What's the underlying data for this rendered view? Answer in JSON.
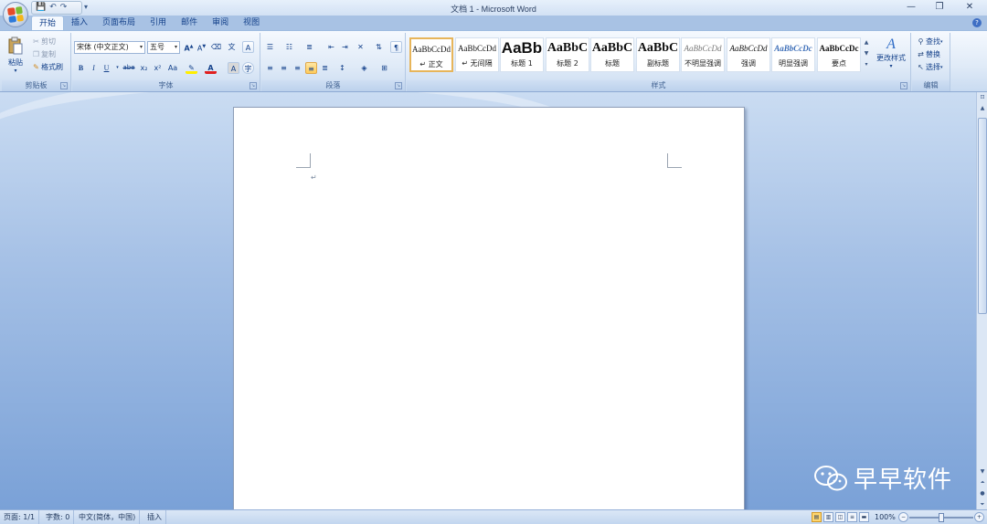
{
  "window": {
    "title": "文档 1 - Microsoft Word",
    "minimize": "—",
    "restore": "❐",
    "close": "✕"
  },
  "qat": {
    "save": "💾",
    "undo": "↶",
    "redo": "↷",
    "more": "▾"
  },
  "tabs": [
    "开始",
    "插入",
    "页面布局",
    "引用",
    "邮件",
    "审阅",
    "视图"
  ],
  "help": "?",
  "clipboard": {
    "label": "剪贴板",
    "paste": "粘贴",
    "cut": "剪切",
    "copy": "复制",
    "format_painter": "格式刷"
  },
  "font": {
    "label": "字体",
    "name": "宋体 (中文正文)",
    "size": "五号",
    "bold": "B",
    "italic": "I",
    "underline": "U",
    "strike": "abe",
    "subscript": "x₂",
    "superscript": "x²",
    "change_case": "Aa",
    "grow": "A",
    "shrink": "A",
    "clear": "A",
    "font_color": "A",
    "char_shading": "A",
    "enclose": "字"
  },
  "paragraph": {
    "label": "段落"
  },
  "styles": {
    "label": "样式",
    "change_styles": "更改样式",
    "items": [
      {
        "sample": "AaBbCcDd",
        "name": "↵ 正文"
      },
      {
        "sample": "AaBbCcDd",
        "name": "↵ 无间隔"
      },
      {
        "sample": "AaBb",
        "name": "标题 1"
      },
      {
        "sample": "AaBbC",
        "name": "标题 2"
      },
      {
        "sample": "AaBbC",
        "name": "标题"
      },
      {
        "sample": "AaBbC",
        "name": "副标题"
      },
      {
        "sample": "AaBbCcDd",
        "name": "不明显强调"
      },
      {
        "sample": "AaBbCcDd",
        "name": "强调"
      },
      {
        "sample": "AaBbCcDc",
        "name": "明显强调"
      },
      {
        "sample": "AaBbCcDc",
        "name": "要点"
      }
    ]
  },
  "editing": {
    "label": "编辑",
    "find": "查找",
    "replace": "替换",
    "select": "选择"
  },
  "document": {
    "paragraph_mark": "↵"
  },
  "watermark": {
    "text": "早早软件"
  },
  "status": {
    "page": "页面: 1/1",
    "words": "字数: 0",
    "language": "中文(简体，中国)",
    "mode": "插入",
    "zoom": "100%"
  },
  "colors": {
    "accent": "#15428b",
    "ribbon_top": "#f5f9fe",
    "workspace": "#a6c1e6",
    "selected_style": "#e7b55a"
  }
}
